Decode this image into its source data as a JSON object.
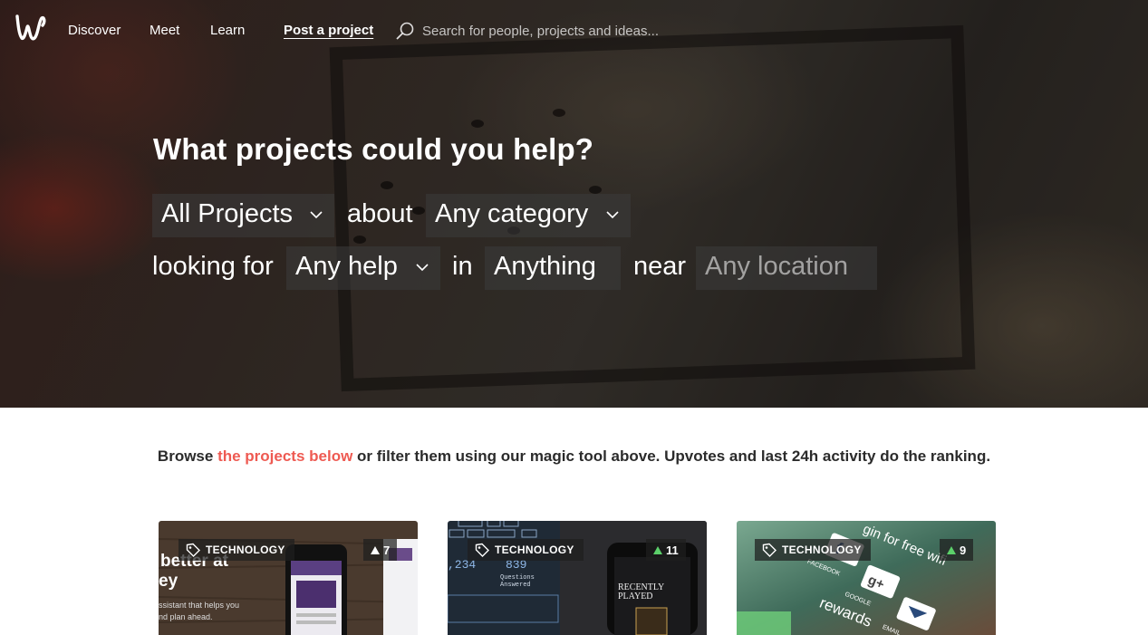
{
  "nav": {
    "links": [
      "Discover",
      "Meet",
      "Learn"
    ],
    "post_label": "Post a project",
    "search_placeholder": "Search for people, projects and ideas..."
  },
  "hero": {
    "title": "What projects could you help?",
    "filter": {
      "projects_value": "All Projects",
      "about_word": "about",
      "category_value": "Any category",
      "looking_for_word": "looking for",
      "help_value": "Any help",
      "in_word": "in",
      "skill_value": "Anything",
      "near_word": "near",
      "location_placeholder": "Any location"
    }
  },
  "browse": {
    "prefix": "Browse ",
    "link": "the projects below",
    "suffix": " or filter them using our magic tool above. Upvotes and last 24h activity do the ranking."
  },
  "cards": [
    {
      "tag": "TECHNOLOGY",
      "votes": "7",
      "image_text": [
        "better at",
        "ey",
        "ssistant that helps you",
        "nd plan ahead."
      ]
    },
    {
      "tag": "TECHNOLOGY",
      "votes": "11",
      "image_text": [
        "RECENTLY",
        "PLAYED",
        ",234",
        "839",
        "Questions",
        "Answered"
      ]
    },
    {
      "tag": "TECHNOLOGY",
      "votes": "9",
      "image_text": [
        "gin for free wifi",
        "rewards",
        "FACEBOOK",
        "GOOGLE",
        "EMAIL"
      ]
    }
  ],
  "colors": {
    "accent": "#ee5a52",
    "upvote_green": "#5cd06a"
  }
}
